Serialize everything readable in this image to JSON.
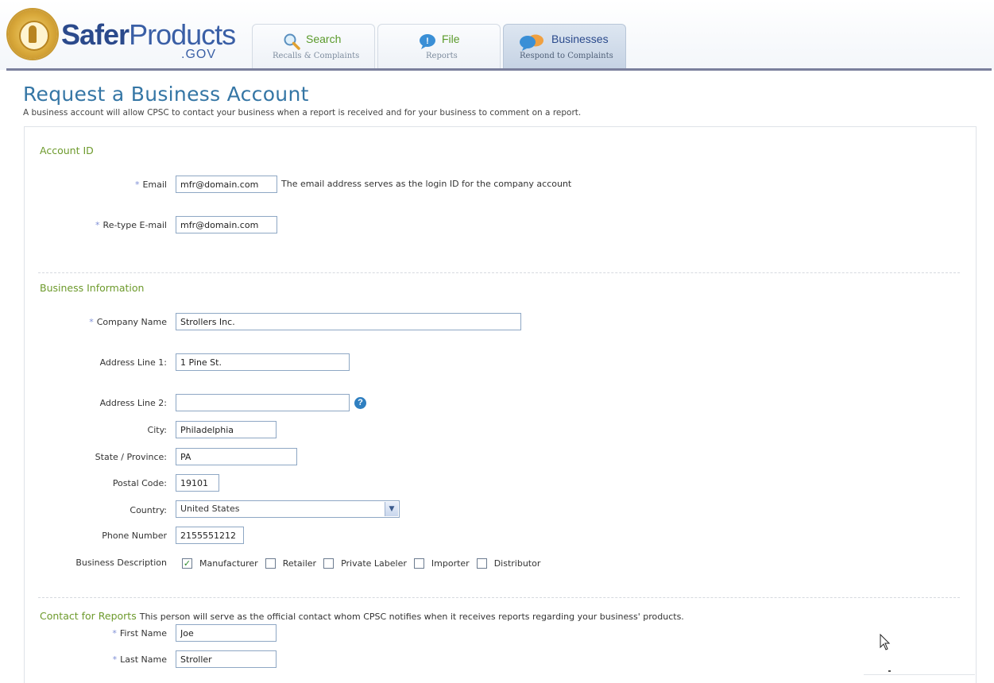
{
  "header": {
    "logo": {
      "word1": "Safer",
      "word2": "Products",
      "suffix": ".GOV"
    },
    "tabs": [
      {
        "title": "Search",
        "subtitle": "Recalls & Complaints",
        "icon": "magnifier-icon",
        "active": false
      },
      {
        "title": "File",
        "subtitle": "Reports",
        "icon": "speech-bubble-icon",
        "active": false
      },
      {
        "title": "Businesses",
        "subtitle": "Respond to Complaints",
        "icon": "chat-bubbles-icon",
        "active": true
      }
    ]
  },
  "page": {
    "title": "Request a Business Account",
    "description": "A business account will allow CPSC to contact your business when a report is received and for your business to comment on a report."
  },
  "account_id": {
    "section_title": "Account ID",
    "email_label": "Email",
    "email_value": "mfr@domain.com",
    "email_hint": "The email address serves as the login ID for the company account",
    "retype_label": "Re-type E-mail",
    "retype_value": "mfr@domain.com"
  },
  "business_info": {
    "section_title": "Business Information",
    "company_label": "Company Name",
    "company_value": "Strollers Inc.",
    "address1_label": "Address Line 1:",
    "address1_value": "1 Pine St.",
    "address2_label": "Address Line 2:",
    "address2_value": "",
    "city_label": "City:",
    "city_value": "Philadelphia",
    "state_label": "State / Province:",
    "state_value": "PA",
    "postal_label": "Postal Code:",
    "postal_value": "19101",
    "country_label": "Country:",
    "country_value": "United States",
    "phone_label": "Phone Number",
    "phone_value": "2155551212",
    "description_label": "Business Description",
    "description_options": [
      {
        "label": "Manufacturer",
        "checked": true
      },
      {
        "label": "Retailer",
        "checked": false
      },
      {
        "label": "Private Labeler",
        "checked": false
      },
      {
        "label": "Importer",
        "checked": false
      },
      {
        "label": "Distributor",
        "checked": false
      }
    ]
  },
  "contact": {
    "section_title": "Contact for Reports",
    "description": "This person will serve as the official contact whom CPSC notifies when it receives reports regarding your business' products.",
    "first_name_label": "First Name",
    "first_name_value": "Joe",
    "last_name_label": "Last Name",
    "last_name_value": "Stroller"
  },
  "colors": {
    "brand_blue": "#2b4a8c",
    "title_blue": "#3576a5",
    "section_green": "#6d9a2c",
    "required_star": "#7f8fd6"
  },
  "required_marker": "*",
  "help_icon": "?"
}
